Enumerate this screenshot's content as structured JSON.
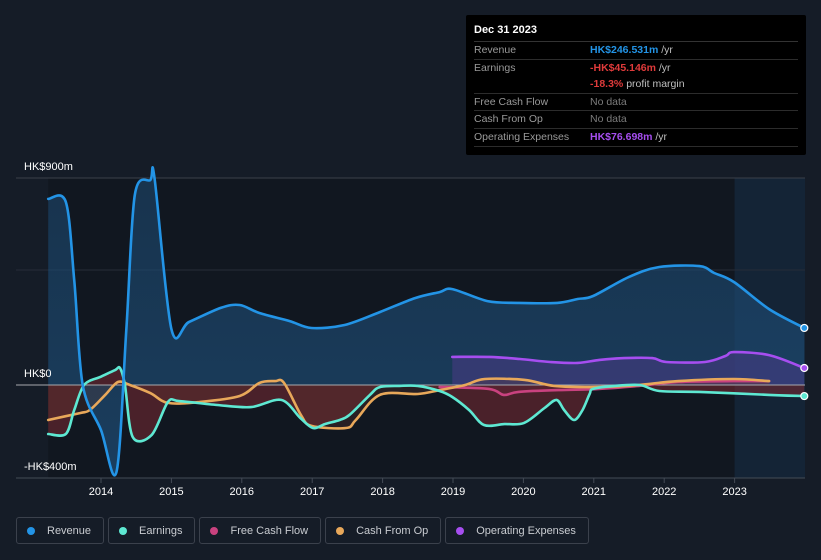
{
  "tooltip": {
    "date": "Dec 31 2023",
    "rows": [
      {
        "label": "Revenue",
        "value": "HK$246.531m",
        "unit": " /yr",
        "color": "#2394e6"
      },
      {
        "label": "Earnings",
        "value": "-HK$45.146m",
        "unit": " /yr",
        "color": "#e03b3b"
      },
      {
        "label": "",
        "value": "-18.3%",
        "unit": " profit margin",
        "color": "#e03b3b"
      },
      {
        "label": "Free Cash Flow",
        "value": "No data",
        "unit": "",
        "color": "#7c7c7c"
      },
      {
        "label": "Cash From Op",
        "value": "No data",
        "unit": "",
        "color": "#7c7c7c"
      },
      {
        "label": "Operating Expenses",
        "value": "HK$76.698m",
        "unit": " /yr",
        "color": "#a64ef0"
      }
    ]
  },
  "legend": [
    {
      "label": "Revenue",
      "color": "#2394e6"
    },
    {
      "label": "Earnings",
      "color": "#5ee8d2"
    },
    {
      "label": "Free Cash Flow",
      "color": "#c9427f"
    },
    {
      "label": "Cash From Op",
      "color": "#e8a85a"
    },
    {
      "label": "Operating Expenses",
      "color": "#a64ef0"
    }
  ],
  "chart_data": {
    "type": "line",
    "title": "",
    "xlabel": "",
    "ylabel": "",
    "currency": "HK$",
    "ylim": [
      -400,
      900
    ],
    "xlim": [
      2013.25,
      2024.0
    ],
    "y_tick_labels": [
      {
        "value": 900,
        "label": "HK$900m"
      },
      {
        "value": 0,
        "label": "HK$0"
      },
      {
        "value": -400,
        "label": "-HK$400m"
      }
    ],
    "gridlines": [
      900,
      500,
      0
    ],
    "x_ticks": [
      2014,
      2015,
      2016,
      2017,
      2018,
      2019,
      2020,
      2021,
      2022,
      2023
    ],
    "x_tick_labels": [
      "2014",
      "2015",
      "2016",
      "2017",
      "2018",
      "2019",
      "2020",
      "2021",
      "2022",
      "2023"
    ],
    "highlight_from": 2023.0,
    "legend_position": "bottom",
    "series": [
      {
        "name": "Revenue",
        "color": "#2394e6",
        "fill": true,
        "points": [
          [
            2013.25,
            809
          ],
          [
            2013.5,
            796
          ],
          [
            2013.62,
            457
          ],
          [
            2013.74,
            0
          ],
          [
            2014.0,
            -196
          ],
          [
            2014.22,
            -378
          ],
          [
            2014.36,
            239
          ],
          [
            2014.48,
            826
          ],
          [
            2014.7,
            891
          ],
          [
            2014.76,
            900
          ],
          [
            2015.0,
            243
          ],
          [
            2015.25,
            274
          ],
          [
            2015.7,
            335
          ],
          [
            2015.97,
            348
          ],
          [
            2016.25,
            313
          ],
          [
            2016.68,
            278
          ],
          [
            2016.99,
            248
          ],
          [
            2017.46,
            261
          ],
          [
            2017.96,
            317
          ],
          [
            2018.46,
            378
          ],
          [
            2018.81,
            404
          ],
          [
            2018.99,
            417
          ],
          [
            2019.49,
            365
          ],
          [
            2019.94,
            357
          ],
          [
            2020.48,
            357
          ],
          [
            2020.77,
            374
          ],
          [
            2020.99,
            387
          ],
          [
            2021.5,
            470
          ],
          [
            2021.93,
            513
          ],
          [
            2022.5,
            517
          ],
          [
            2022.71,
            487
          ],
          [
            2022.99,
            448
          ],
          [
            2023.49,
            330
          ],
          [
            2023.99,
            248
          ]
        ]
      },
      {
        "name": "Earnings",
        "color": "#5ee8d2",
        "fill": true,
        "points": [
          [
            2013.25,
            -213
          ],
          [
            2013.5,
            -213
          ],
          [
            2013.62,
            -109
          ],
          [
            2013.76,
            0
          ],
          [
            2013.99,
            35
          ],
          [
            2014.2,
            65
          ],
          [
            2014.27,
            74
          ],
          [
            2014.34,
            0
          ],
          [
            2014.45,
            -226
          ],
          [
            2014.72,
            -217
          ],
          [
            2014.95,
            -74
          ],
          [
            2015.11,
            -70
          ],
          [
            2015.65,
            -87
          ],
          [
            2016.13,
            -96
          ],
          [
            2016.56,
            -65
          ],
          [
            2016.83,
            -143
          ],
          [
            2017.01,
            -187
          ],
          [
            2017.18,
            -170
          ],
          [
            2017.39,
            -152
          ],
          [
            2017.53,
            -130
          ],
          [
            2017.82,
            -43
          ],
          [
            2017.96,
            -9
          ],
          [
            2018.24,
            -4
          ],
          [
            2018.5,
            -4
          ],
          [
            2018.81,
            -26
          ],
          [
            2018.99,
            -52
          ],
          [
            2019.23,
            -109
          ],
          [
            2019.44,
            -174
          ],
          [
            2019.73,
            -170
          ],
          [
            2020.01,
            -165
          ],
          [
            2020.3,
            -100
          ],
          [
            2020.47,
            -65
          ],
          [
            2020.58,
            -109
          ],
          [
            2020.72,
            -152
          ],
          [
            2020.84,
            -109
          ],
          [
            2020.94,
            -39
          ],
          [
            2020.99,
            -17
          ],
          [
            2021.29,
            -4
          ],
          [
            2021.65,
            0
          ],
          [
            2021.93,
            -26
          ],
          [
            2022.5,
            -30
          ],
          [
            2023.49,
            -43
          ],
          [
            2023.99,
            -48
          ]
        ]
      },
      {
        "name": "Free Cash Flow",
        "color": "#c9427f",
        "fill": true,
        "points": [
          [
            2018.81,
            -9
          ],
          [
            2019.51,
            -17
          ],
          [
            2019.72,
            -43
          ],
          [
            2019.93,
            -30
          ],
          [
            2020.5,
            -22
          ],
          [
            2021.07,
            -17
          ],
          [
            2021.64,
            -4
          ],
          [
            2022.2,
            13
          ],
          [
            2022.99,
            17
          ],
          [
            2023.49,
            17
          ]
        ]
      },
      {
        "name": "Cash From Op",
        "color": "#e8a85a",
        "fill": true,
        "points": [
          [
            2013.25,
            -152
          ],
          [
            2013.7,
            -122
          ],
          [
            2013.84,
            -109
          ],
          [
            2014.06,
            -43
          ],
          [
            2014.24,
            13
          ],
          [
            2014.41,
            0
          ],
          [
            2014.7,
            -35
          ],
          [
            2014.95,
            -78
          ],
          [
            2015.4,
            -74
          ],
          [
            2015.97,
            -48
          ],
          [
            2016.25,
            9
          ],
          [
            2016.47,
            17
          ],
          [
            2016.6,
            9
          ],
          [
            2016.84,
            -130
          ],
          [
            2016.99,
            -178
          ],
          [
            2017.48,
            -187
          ],
          [
            2017.62,
            -152
          ],
          [
            2017.96,
            -43
          ],
          [
            2018.5,
            -39
          ],
          [
            2018.81,
            -22
          ],
          [
            2019.17,
            0
          ],
          [
            2019.45,
            26
          ],
          [
            2020.02,
            22
          ],
          [
            2020.44,
            -4
          ],
          [
            2021.07,
            -9
          ],
          [
            2021.64,
            0
          ],
          [
            2022.2,
            17
          ],
          [
            2022.99,
            26
          ],
          [
            2023.49,
            17
          ]
        ]
      },
      {
        "name": "Operating Expenses",
        "color": "#a64ef0",
        "fill": true,
        "points": [
          [
            2018.99,
            122
          ],
          [
            2019.52,
            122
          ],
          [
            2019.95,
            113
          ],
          [
            2020.38,
            100
          ],
          [
            2020.77,
            96
          ],
          [
            2021.08,
            109
          ],
          [
            2021.43,
            117
          ],
          [
            2021.83,
            117
          ],
          [
            2022.03,
            100
          ],
          [
            2022.58,
            100
          ],
          [
            2022.87,
            126
          ],
          [
            2022.99,
            143
          ],
          [
            2023.49,
            130
          ],
          [
            2023.99,
            74
          ]
        ]
      }
    ]
  }
}
